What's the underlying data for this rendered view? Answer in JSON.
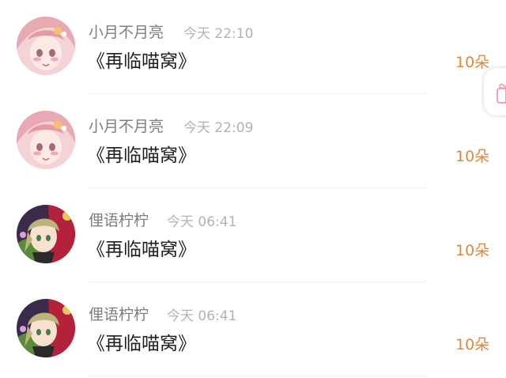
{
  "messages": [
    {
      "name": "小月不月亮",
      "time": "今天 22:10",
      "content": "《再临喵窝》",
      "gift": "10朵",
      "avatar": "pink-hair-anime-avatar"
    },
    {
      "name": "小月不月亮",
      "time": "今天 22:09",
      "content": "《再临喵窝》",
      "gift": "10朵",
      "avatar": "pink-hair-anime-avatar"
    },
    {
      "name": "俚语柠柠",
      "time": "今天 06:41",
      "content": "《再临喵窝》",
      "gift": "10朵",
      "avatar": "green-hair-anime-avatar"
    },
    {
      "name": "俚语柠柠",
      "time": "今天 06:41",
      "content": "《再临喵窝》",
      "gift": "10朵",
      "avatar": "green-hair-anime-avatar"
    }
  ],
  "floating_button": {
    "icon": "gift-box-icon"
  },
  "colors": {
    "name": "#7d7d7d",
    "time": "#b3b3b3",
    "message": "#1f1f1f",
    "gift": "#e0883c",
    "divider": "#f0f0f0"
  }
}
